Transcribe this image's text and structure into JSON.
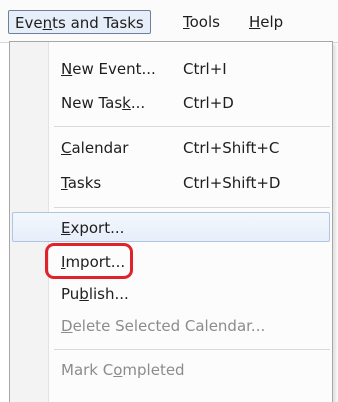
{
  "menubar": {
    "events_tasks": {
      "pre": "Eve",
      "u": "n",
      "post": "ts and Tasks"
    },
    "tools": {
      "pre": "",
      "u": "T",
      "post": "ools"
    },
    "help": {
      "pre": "",
      "u": "H",
      "post": "elp"
    }
  },
  "menu": {
    "new_event": {
      "pre": "",
      "u": "N",
      "post": "ew Event...",
      "shortcut": "Ctrl+I"
    },
    "new_task": {
      "pre": "New Tas",
      "u": "k",
      "post": "...",
      "shortcut": "Ctrl+D"
    },
    "calendar": {
      "pre": "",
      "u": "C",
      "post": "alendar",
      "shortcut": "Ctrl+Shift+C"
    },
    "tasks": {
      "pre": "",
      "u": "T",
      "post": "asks",
      "shortcut": "Ctrl+Shift+D"
    },
    "export": {
      "pre": "",
      "u": "E",
      "post": "xport..."
    },
    "import": {
      "pre": "",
      "u": "I",
      "post": "mport..."
    },
    "publish": {
      "pre": "Pu",
      "u": "b",
      "post": "lish..."
    },
    "delete_calendar": {
      "pre": "",
      "u": "D",
      "post": "elete Selected Calendar..."
    },
    "mark_completed": {
      "pre": "Mark C",
      "u": "o",
      "post": "mpleted"
    }
  },
  "colors": {
    "callout": "#e0232b",
    "highlight": "#e7eefa",
    "disabled_text": "#8c8c8c"
  }
}
